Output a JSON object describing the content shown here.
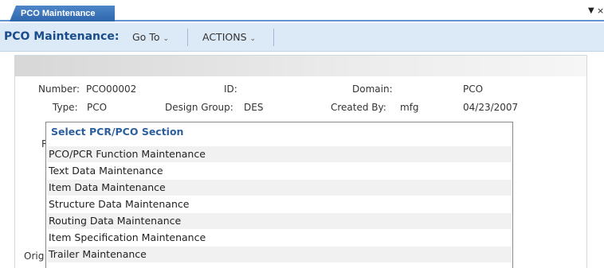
{
  "tab": {
    "label": "PCO Maintenance"
  },
  "toolbar": {
    "title": "PCO Maintenance:",
    "goto_label": "Go To",
    "actions_label": "ACTIONS"
  },
  "form": {
    "number_label": "Number:",
    "number_value": "PCO00002",
    "id_label": "ID:",
    "domain_label": "Domain:",
    "domain_value": "PCO",
    "type_label": "Type:",
    "type_value": "PCO",
    "design_group_label": "Design Group:",
    "design_group_value": "DES",
    "created_by_label": "Created By:",
    "created_by_value": "mfg",
    "created_date": "04/23/2007",
    "partial_r": "R",
    "partial_orig": "Orig"
  },
  "popup": {
    "title": "Select PCR/PCO Section",
    "items": [
      "PCO/PCR Function Maintenance",
      "Text Data Maintenance",
      "Item Data Maintenance",
      "Structure Data Maintenance",
      "Routing Data Maintenance",
      "Item Specification Maintenance",
      "Trailer Maintenance"
    ]
  },
  "icons": {
    "tab_menu": "dropdown-arrow-icon",
    "tab_close": "close-icon",
    "menu_caret": "chevron-down-icon"
  }
}
